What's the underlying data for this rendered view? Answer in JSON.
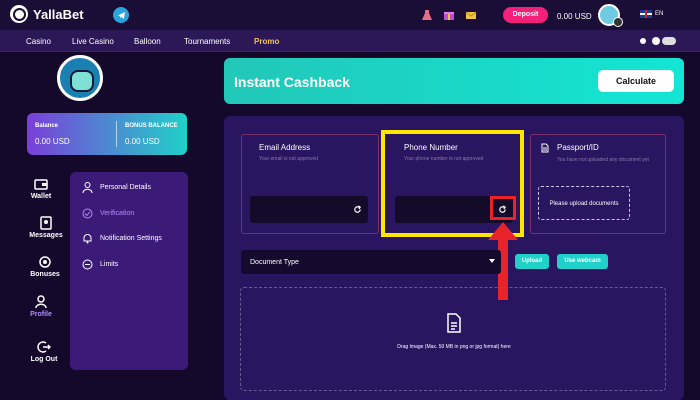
{
  "header": {
    "logo_text": "YallaBet",
    "deposit_label": "Deposit",
    "balance": "0.00 USD",
    "language": "EN"
  },
  "nav": {
    "items": [
      "Casino",
      "Live Casino",
      "Balloon",
      "Tournaments",
      "Promo"
    ]
  },
  "sidebar": {
    "balance_label": "Balance",
    "balance_value": "0.00 USD",
    "bonus_label": "BONUS BALANCE",
    "bonus_value": "0.00 USD",
    "items": [
      "Wallet",
      "Messages",
      "Bonuses",
      "Profile",
      "Log Out"
    ],
    "active_item": "Profile"
  },
  "profile_menu": {
    "items": [
      "Personal Details",
      "Verification",
      "Notification Settings",
      "Limits"
    ],
    "active_item": "Verification"
  },
  "cashback": {
    "title": "Instant Cashback",
    "button_label": "Calculate"
  },
  "verification": {
    "email": {
      "title": "Email Address",
      "status": "Your email is not approved"
    },
    "phone": {
      "title": "Phone Number",
      "status": "Your phone number is not approved"
    },
    "passport": {
      "title": "Passport/ID",
      "status": "You have not uploaded any document yet",
      "upload_label": "Please upload documents"
    },
    "document_type_label": "Document Type",
    "upload_button": "Upload",
    "webcam_button": "Use webcam",
    "drop_text": "Drag Image (Max. 50 MB in png or jpg format) here"
  },
  "colors": {
    "accent_teal": "#1fd1c9",
    "deposit_pink": "#f4207a",
    "highlight_yellow": "#ffe600",
    "highlight_red": "#e8232a",
    "promo_gold": "#f4c542"
  }
}
